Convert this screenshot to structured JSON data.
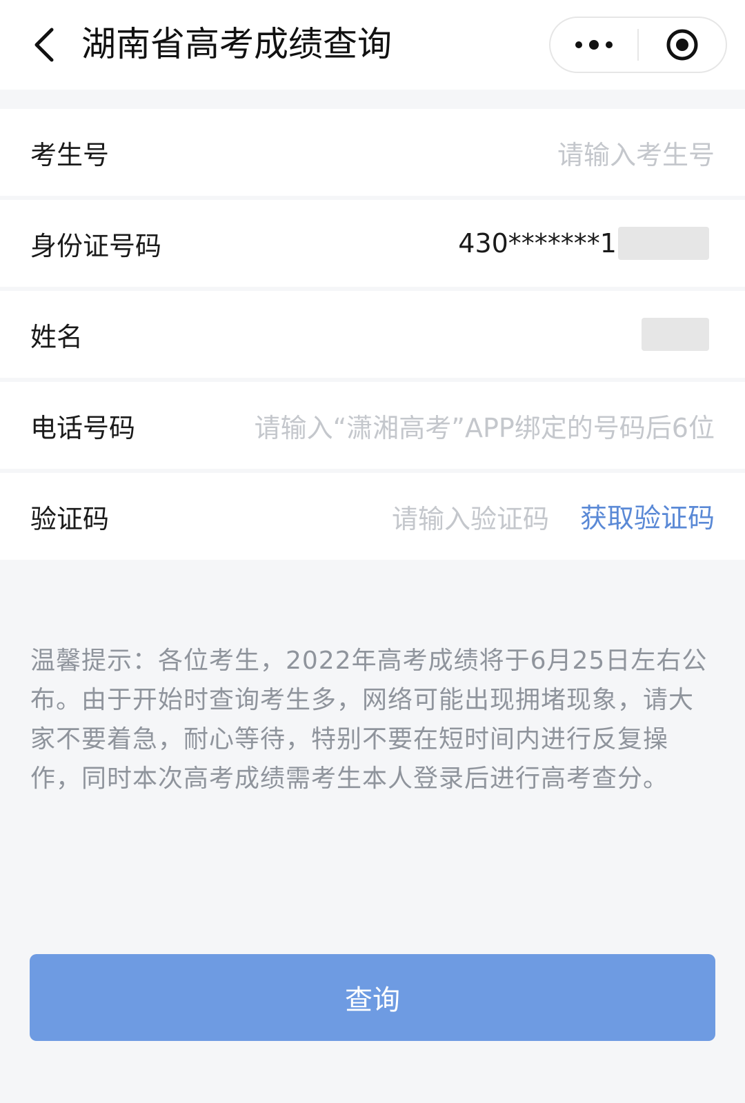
{
  "header": {
    "title": "湖南省高考成绩查询",
    "back_icon": "chevron-left-icon",
    "more_icon": "more-dots-icon",
    "close_icon": "target-circle-icon"
  },
  "form": {
    "exam_number": {
      "label": "考生号",
      "placeholder": "请输入考生号"
    },
    "id_number": {
      "label": "身份证号码",
      "value": "430*******1"
    },
    "name": {
      "label": "姓名",
      "value": ""
    },
    "phone": {
      "label": "电话号码",
      "placeholder": "请输入“潇湘高考”APP绑定的号码后6位"
    },
    "verify_code": {
      "label": "验证码",
      "placeholder": "请输入验证码",
      "get_code_label": "获取验证码"
    }
  },
  "notice": {
    "text": "温馨提示：各位考生，2022年高考成绩将于6月25日左右公布。由于开始时查询考生多，网络可能出现拥堵现象，请大家不要着急，耐心等待，特别不要在短时间内进行反复操作，同时本次高考成绩需考生本人登录后进行高考查分。"
  },
  "submit": {
    "label": "查询"
  },
  "colors": {
    "accent": "#5a89d6",
    "button": "#6e9be2",
    "placeholder": "#c4c7cc",
    "background": "#f5f6f8"
  }
}
